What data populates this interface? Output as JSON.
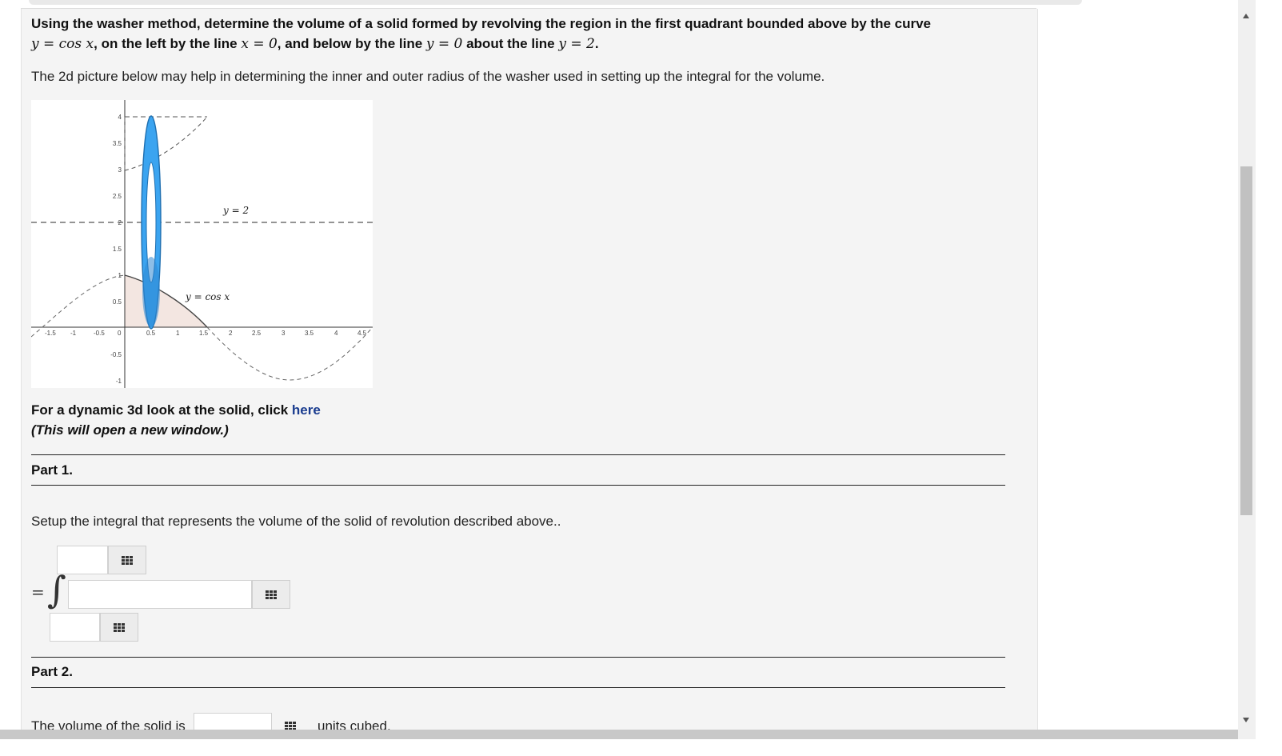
{
  "question": {
    "line1": "Using the washer method, determine the volume of a solid formed by revolving the region in the first quadrant bounded above by the curve",
    "line2": {
      "m1": "y = cos x",
      "t1": ", on the left by the line ",
      "m2": "x = 0",
      "t2": ", and below by the line ",
      "m3": "y = 0",
      "t3": " about the line ",
      "m4": "y = 2",
      "t4": "."
    },
    "hint": "The 2d picture below may help in determining the inner and outer radius of the washer used in setting up the integral for the volume."
  },
  "figure": {
    "label_line": "y = 2",
    "label_curve": "y = cos x",
    "x_ticks": [
      "-1.5",
      "-1",
      "-0.5",
      "0",
      "0.5",
      "1",
      "1.5",
      "2",
      "2.5",
      "3",
      "3.5",
      "4",
      "4.5"
    ],
    "y_ticks": [
      "4",
      "3.5",
      "3",
      "2.5",
      "2",
      "1.5",
      "1",
      "0.5",
      "-0.5",
      "-1"
    ],
    "colors": {
      "washer": "#3ba4f0",
      "washer_edge": "#1f6fb0",
      "region": "#f3e6e1",
      "curve": "#444444"
    }
  },
  "dynamic": {
    "text": "For a dynamic 3d look at the solid, click ",
    "link": "here",
    "note": "(This will open a new window.)"
  },
  "part1": {
    "title": "Part 1.",
    "prompt": "Setup the integral that represents the volume of the solid of revolution described above..",
    "equals": "=",
    "integral": "∫",
    "upper_value": "",
    "lower_value": "",
    "integrand_value": ""
  },
  "part2": {
    "title": "Part 2.",
    "prompt": "The volume of the solid is",
    "answer_value": "",
    "units": "units cubed."
  },
  "icons": {
    "keyboard": "keyboard-grid-icon"
  }
}
